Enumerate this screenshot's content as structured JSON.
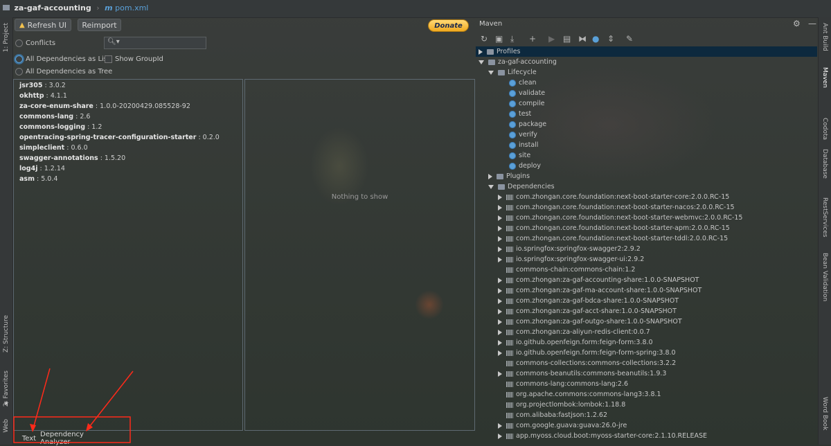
{
  "breadcrumb": {
    "project": "za-gaf-accounting",
    "file": "pom.xml"
  },
  "toolbar": {
    "refresh_label": "Refresh UI",
    "reimport_label": "Reimport",
    "donate_label": "Donate"
  },
  "filters": {
    "conflicts": "Conflicts",
    "all_list": "All Dependencies as List",
    "all_tree": "All Dependencies as Tree",
    "show_groupid": "Show GroupId",
    "search_placeholder": ""
  },
  "dependencies": [
    {
      "name": "jsr305",
      "version": " : 3.0.2"
    },
    {
      "name": "okhttp",
      "version": " : 4.1.1"
    },
    {
      "name": "za-core-enum-share",
      "version": " : 1.0.0-20200429.085528-92"
    },
    {
      "name": "commons-lang",
      "version": " : 2.6"
    },
    {
      "name": "commons-logging",
      "version": " : 1.2"
    },
    {
      "name": "opentracing-spring-tracer-configuration-starter",
      "version": " : 0.2.0"
    },
    {
      "name": "simpleclient",
      "version": " : 0.6.0"
    },
    {
      "name": "swagger-annotations",
      "version": " : 1.5.20"
    },
    {
      "name": "log4j",
      "version": " : 1.2.14"
    },
    {
      "name": "asm",
      "version": " : 5.0.4"
    }
  ],
  "empty_panel": "Nothing to show",
  "bottom_tabs": {
    "text": "Text",
    "analyzer": "Dependency Analyzer"
  },
  "left_tools": {
    "project": "1: Project",
    "structure": "Z: Structure",
    "favorites": "2: Favorites",
    "web": "Web"
  },
  "right_tools": {
    "ant": "Ant Build",
    "maven": "Maven",
    "codota": "Codota",
    "database": "Database",
    "rest": "RestServices",
    "bean": "Bean Validation",
    "word": "Word Book"
  },
  "maven": {
    "title": "Maven",
    "profiles": "Profiles",
    "project": "za-gaf-accounting",
    "lifecycle": "Lifecycle",
    "phases": [
      "clean",
      "validate",
      "compile",
      "test",
      "package",
      "verify",
      "install",
      "site",
      "deploy"
    ],
    "plugins": "Plugins",
    "deps_label": "Dependencies",
    "deps": [
      {
        "name": "com.zhongan.core.foundation:next-boot-starter-core:2.0.0.RC-15",
        "expandable": true
      },
      {
        "name": "com.zhongan.core.foundation:next-boot-starter-nacos:2.0.0.RC-15",
        "expandable": true
      },
      {
        "name": "com.zhongan.core.foundation:next-boot-starter-webmvc:2.0.0.RC-15",
        "expandable": true
      },
      {
        "name": "com.zhongan.core.foundation:next-boot-starter-apm:2.0.0.RC-15",
        "expandable": true
      },
      {
        "name": "com.zhongan.core.foundation:next-boot-starter-tddl:2.0.0.RC-15",
        "expandable": true
      },
      {
        "name": "io.springfox:springfox-swagger2:2.9.2",
        "expandable": true
      },
      {
        "name": "io.springfox:springfox-swagger-ui:2.9.2",
        "expandable": true
      },
      {
        "name": "commons-chain:commons-chain:1.2",
        "expandable": false
      },
      {
        "name": "com.zhongan:za-gaf-accounting-share:1.0.0-SNAPSHOT",
        "expandable": true
      },
      {
        "name": "com.zhongan:za-gaf-ma-account-share:1.0.0-SNAPSHOT",
        "expandable": true
      },
      {
        "name": "com.zhongan:za-gaf-bdca-share:1.0.0-SNAPSHOT",
        "expandable": true
      },
      {
        "name": "com.zhongan:za-gaf-acct-share:1.0.0-SNAPSHOT",
        "expandable": true
      },
      {
        "name": "com.zhongan:za-gaf-outgo-share:1.0.0-SNAPSHOT",
        "expandable": true
      },
      {
        "name": "com.zhongan:za-aliyun-redis-client:0.0.7",
        "expandable": true
      },
      {
        "name": "io.github.openfeign.form:feign-form:3.8.0",
        "expandable": true
      },
      {
        "name": "io.github.openfeign.form:feign-form-spring:3.8.0",
        "expandable": true
      },
      {
        "name": "commons-collections:commons-collections:3.2.2",
        "expandable": false
      },
      {
        "name": "commons-beanutils:commons-beanutils:1.9.3",
        "expandable": true
      },
      {
        "name": "commons-lang:commons-lang:2.6",
        "expandable": false
      },
      {
        "name": "org.apache.commons:commons-lang3:3.8.1",
        "expandable": false
      },
      {
        "name": "org.projectlombok:lombok:1.18.8",
        "expandable": false
      },
      {
        "name": "com.alibaba:fastjson:1.2.62",
        "expandable": false
      },
      {
        "name": "com.google.guava:guava:26.0-jre",
        "expandable": true
      },
      {
        "name": "app.myoss.cloud.boot:myoss-starter-core:2.1.10.RELEASE",
        "expandable": true
      }
    ]
  },
  "colors": {
    "selection": "#0d293e",
    "accent": "#5aa0d8",
    "annotation": "#ff2a1a"
  }
}
